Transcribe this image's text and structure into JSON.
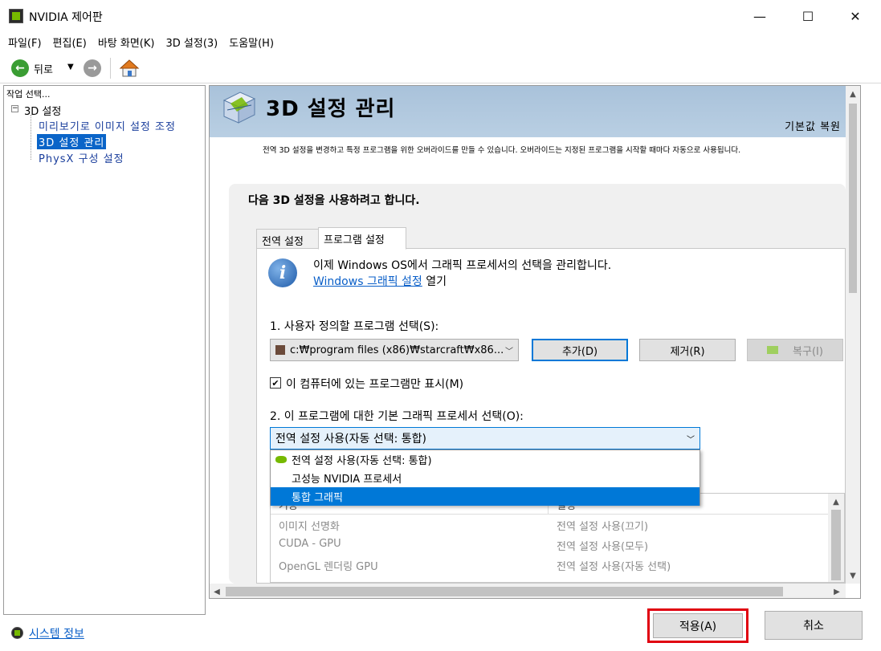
{
  "window": {
    "title": "NVIDIA 제어판",
    "minimize": "—",
    "maximize": "☐",
    "close": "✕"
  },
  "menu": [
    "파일(F)",
    "편집(E)",
    "바탕 화면(K)",
    "3D 설정(3)",
    "도움말(H)"
  ],
  "toolbar": {
    "back_label": "뒤로"
  },
  "left_panel": {
    "header": "작업 선택...",
    "tree": {
      "root": "3D 설정",
      "children": [
        "미리보기로 이미지 설정 조정",
        "3D 설정 관리",
        "PhysX 구성 설정"
      ],
      "selected_index": 1
    },
    "system_info": "시스템 정보"
  },
  "main": {
    "title": "3D 설정 관리",
    "restore_defaults": "기본값 복원",
    "description": "전역 3D 설정을 변경하고 특정 프로그램을 위한 오버라이드를 만들 수 있습니다. 오버라이드는 지정된 프로그램을 시작할 때마다 자동으로 사용됩니다.",
    "section_title": "다음 3D 설정을 사용하려고 합니다.",
    "tabs": [
      {
        "label": "전역 설정",
        "active": false
      },
      {
        "label": "프로그램 설정",
        "active": true
      }
    ],
    "info": {
      "text": "이제 Windows OS에서 그래픽 프로세서의 선택을 관리합니다.",
      "link": "Windows 그래픽 설정",
      "link_suffix": " 열기"
    },
    "step1": {
      "label": "1. 사용자 정의할 프로그램 선택(S):",
      "program_value": "c:₩program files (x86)₩starcraft₩x86...",
      "add_button": "추가(D)",
      "remove_button": "제거(R)",
      "restore_button": "복구(I)",
      "checkbox_label": "이 컴퓨터에 있는 프로그램만 표시(M)",
      "checkbox_checked": true
    },
    "step2": {
      "label": "2. 이 프로그램에 대한 기본 그래픽 프로세서 선택(O):",
      "selected_value": "전역 설정 사용(자동 선택: 통합)",
      "options": [
        "전역 설정 사용(자동 선택: 통합)",
        "고성능 NVIDIA 프로세서",
        "통합 그래픽"
      ],
      "highlighted_index": 2
    },
    "settings_table": {
      "headers": [
        "기능",
        "설정"
      ],
      "rows": [
        {
          "feature": "이미지 선명화",
          "setting": "전역 설정 사용(끄기)"
        },
        {
          "feature": "CUDA - GPU",
          "setting": "전역 설정 사용(모두)"
        },
        {
          "feature": "OpenGL 렌더링 GPU",
          "setting": "전역 설정 사용(자동 선택)"
        }
      ]
    }
  },
  "footer": {
    "apply_button": "적용(A)",
    "cancel_button": "취소"
  },
  "colors": {
    "nvidia_green": "#76b900",
    "selection_blue": "#0078d7",
    "highlight_red": "#e00010",
    "banner": "#b0c8de"
  }
}
